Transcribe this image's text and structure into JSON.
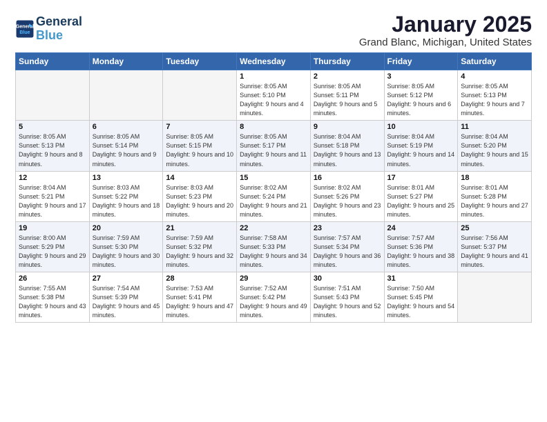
{
  "header": {
    "logo_line1": "General",
    "logo_line2": "Blue",
    "title": "January 2025",
    "subtitle": "Grand Blanc, Michigan, United States"
  },
  "days_of_week": [
    "Sunday",
    "Monday",
    "Tuesday",
    "Wednesday",
    "Thursday",
    "Friday",
    "Saturday"
  ],
  "weeks": [
    [
      {
        "day": "",
        "info": ""
      },
      {
        "day": "",
        "info": ""
      },
      {
        "day": "",
        "info": ""
      },
      {
        "day": "1",
        "info": "Sunrise: 8:05 AM\nSunset: 5:10 PM\nDaylight: 9 hours\nand 4 minutes."
      },
      {
        "day": "2",
        "info": "Sunrise: 8:05 AM\nSunset: 5:11 PM\nDaylight: 9 hours\nand 5 minutes."
      },
      {
        "day": "3",
        "info": "Sunrise: 8:05 AM\nSunset: 5:12 PM\nDaylight: 9 hours\nand 6 minutes."
      },
      {
        "day": "4",
        "info": "Sunrise: 8:05 AM\nSunset: 5:13 PM\nDaylight: 9 hours\nand 7 minutes."
      }
    ],
    [
      {
        "day": "5",
        "info": "Sunrise: 8:05 AM\nSunset: 5:13 PM\nDaylight: 9 hours\nand 8 minutes."
      },
      {
        "day": "6",
        "info": "Sunrise: 8:05 AM\nSunset: 5:14 PM\nDaylight: 9 hours\nand 9 minutes."
      },
      {
        "day": "7",
        "info": "Sunrise: 8:05 AM\nSunset: 5:15 PM\nDaylight: 9 hours\nand 10 minutes."
      },
      {
        "day": "8",
        "info": "Sunrise: 8:05 AM\nSunset: 5:17 PM\nDaylight: 9 hours\nand 11 minutes."
      },
      {
        "day": "9",
        "info": "Sunrise: 8:04 AM\nSunset: 5:18 PM\nDaylight: 9 hours\nand 13 minutes."
      },
      {
        "day": "10",
        "info": "Sunrise: 8:04 AM\nSunset: 5:19 PM\nDaylight: 9 hours\nand 14 minutes."
      },
      {
        "day": "11",
        "info": "Sunrise: 8:04 AM\nSunset: 5:20 PM\nDaylight: 9 hours\nand 15 minutes."
      }
    ],
    [
      {
        "day": "12",
        "info": "Sunrise: 8:04 AM\nSunset: 5:21 PM\nDaylight: 9 hours\nand 17 minutes."
      },
      {
        "day": "13",
        "info": "Sunrise: 8:03 AM\nSunset: 5:22 PM\nDaylight: 9 hours\nand 18 minutes."
      },
      {
        "day": "14",
        "info": "Sunrise: 8:03 AM\nSunset: 5:23 PM\nDaylight: 9 hours\nand 20 minutes."
      },
      {
        "day": "15",
        "info": "Sunrise: 8:02 AM\nSunset: 5:24 PM\nDaylight: 9 hours\nand 21 minutes."
      },
      {
        "day": "16",
        "info": "Sunrise: 8:02 AM\nSunset: 5:26 PM\nDaylight: 9 hours\nand 23 minutes."
      },
      {
        "day": "17",
        "info": "Sunrise: 8:01 AM\nSunset: 5:27 PM\nDaylight: 9 hours\nand 25 minutes."
      },
      {
        "day": "18",
        "info": "Sunrise: 8:01 AM\nSunset: 5:28 PM\nDaylight: 9 hours\nand 27 minutes."
      }
    ],
    [
      {
        "day": "19",
        "info": "Sunrise: 8:00 AM\nSunset: 5:29 PM\nDaylight: 9 hours\nand 29 minutes."
      },
      {
        "day": "20",
        "info": "Sunrise: 7:59 AM\nSunset: 5:30 PM\nDaylight: 9 hours\nand 30 minutes."
      },
      {
        "day": "21",
        "info": "Sunrise: 7:59 AM\nSunset: 5:32 PM\nDaylight: 9 hours\nand 32 minutes."
      },
      {
        "day": "22",
        "info": "Sunrise: 7:58 AM\nSunset: 5:33 PM\nDaylight: 9 hours\nand 34 minutes."
      },
      {
        "day": "23",
        "info": "Sunrise: 7:57 AM\nSunset: 5:34 PM\nDaylight: 9 hours\nand 36 minutes."
      },
      {
        "day": "24",
        "info": "Sunrise: 7:57 AM\nSunset: 5:36 PM\nDaylight: 9 hours\nand 38 minutes."
      },
      {
        "day": "25",
        "info": "Sunrise: 7:56 AM\nSunset: 5:37 PM\nDaylight: 9 hours\nand 41 minutes."
      }
    ],
    [
      {
        "day": "26",
        "info": "Sunrise: 7:55 AM\nSunset: 5:38 PM\nDaylight: 9 hours\nand 43 minutes."
      },
      {
        "day": "27",
        "info": "Sunrise: 7:54 AM\nSunset: 5:39 PM\nDaylight: 9 hours\nand 45 minutes."
      },
      {
        "day": "28",
        "info": "Sunrise: 7:53 AM\nSunset: 5:41 PM\nDaylight: 9 hours\nand 47 minutes."
      },
      {
        "day": "29",
        "info": "Sunrise: 7:52 AM\nSunset: 5:42 PM\nDaylight: 9 hours\nand 49 minutes."
      },
      {
        "day": "30",
        "info": "Sunrise: 7:51 AM\nSunset: 5:43 PM\nDaylight: 9 hours\nand 52 minutes."
      },
      {
        "day": "31",
        "info": "Sunrise: 7:50 AM\nSunset: 5:45 PM\nDaylight: 9 hours\nand 54 minutes."
      },
      {
        "day": "",
        "info": ""
      }
    ]
  ]
}
